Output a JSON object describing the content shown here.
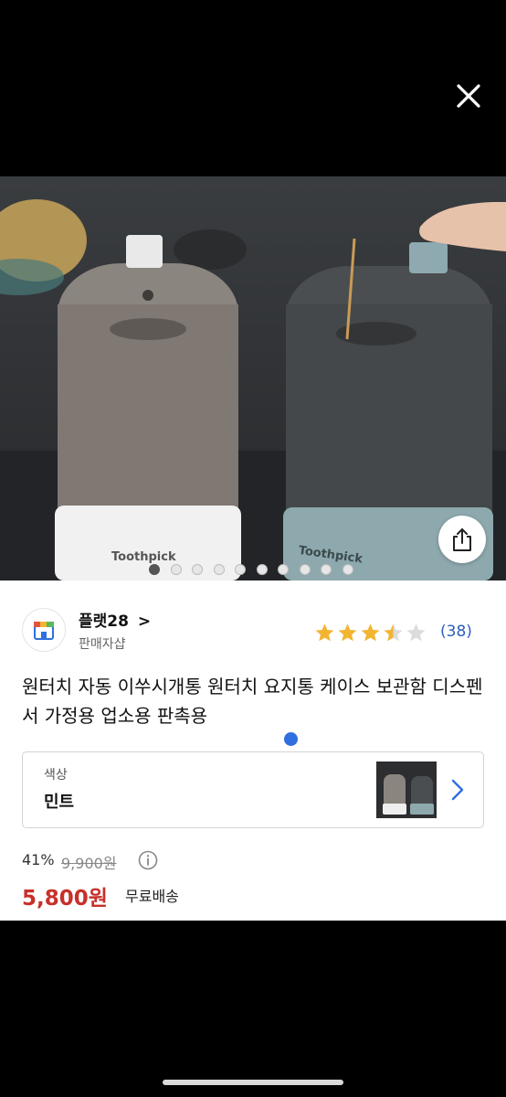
{
  "seller": {
    "name": "플랫28",
    "chevron": ">",
    "type": "판매자샵"
  },
  "rating": {
    "stars": 3.5,
    "count": "(38)",
    "star_color": "#f2b531"
  },
  "product": {
    "title": "원터치 자동 이쑤시개통 원터치 요지통 케이스 보관함 디스펜서 가정용 업소용 판촉용",
    "image_text_left": "Toothpick",
    "image_text_right": "Toothpick"
  },
  "carousel": {
    "total": 10,
    "active_index": 0
  },
  "option": {
    "label": "색상",
    "value": "민트"
  },
  "price": {
    "discount": "41%",
    "original": "9,900원",
    "current": "5,800원",
    "shipping": "무료배송",
    "accent_color": "#c8302a"
  },
  "icons": [
    "close-icon",
    "share-icon",
    "info-icon",
    "chevron-right-icon",
    "star-icon",
    "shop-logo-icon"
  ]
}
